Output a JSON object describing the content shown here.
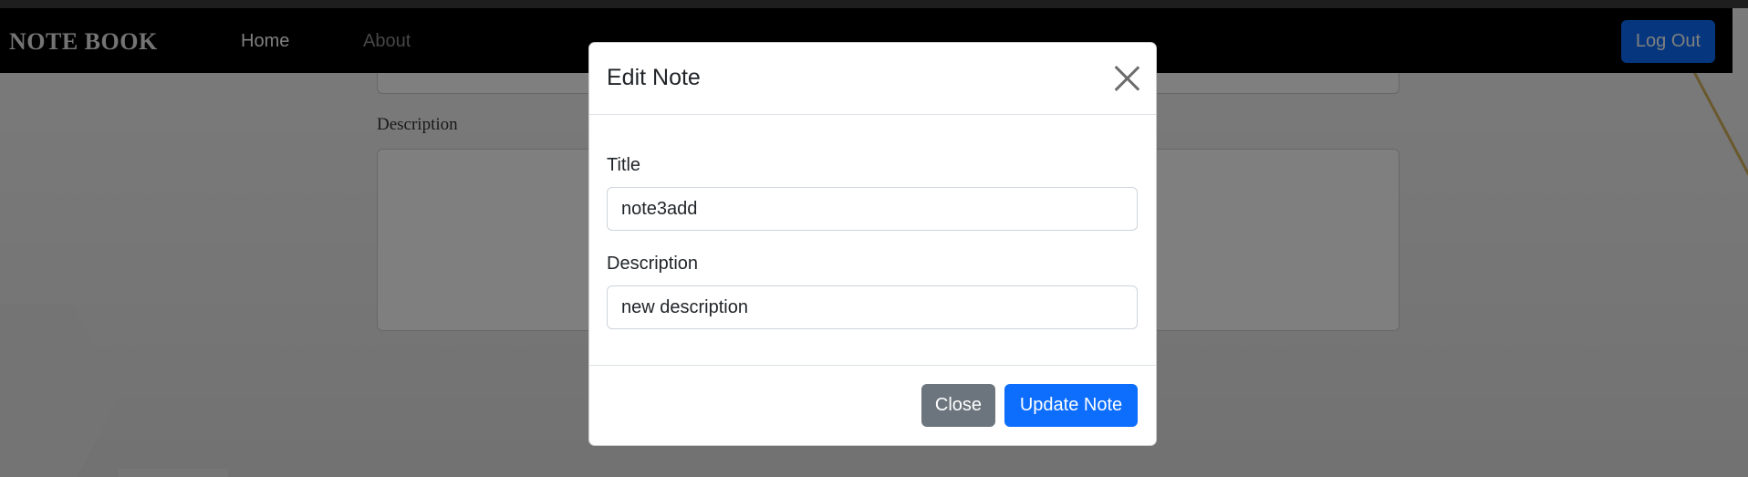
{
  "navbar": {
    "brand": "NOTE BOOK",
    "links": [
      {
        "label": "Home"
      },
      {
        "label": "About"
      }
    ],
    "logout_label": "Log Out"
  },
  "background_form": {
    "description_label": "Description"
  },
  "modal": {
    "title": "Edit Note",
    "title_label": "Title",
    "title_value": "note3add",
    "description_label": "Description",
    "description_value": "new description",
    "close_label": "Close",
    "update_label": "Update Note"
  },
  "colors": {
    "primary": "#0d6efd",
    "secondary": "#6c757d",
    "navbar": "#000000"
  },
  "icons": {
    "close": "close-icon"
  }
}
